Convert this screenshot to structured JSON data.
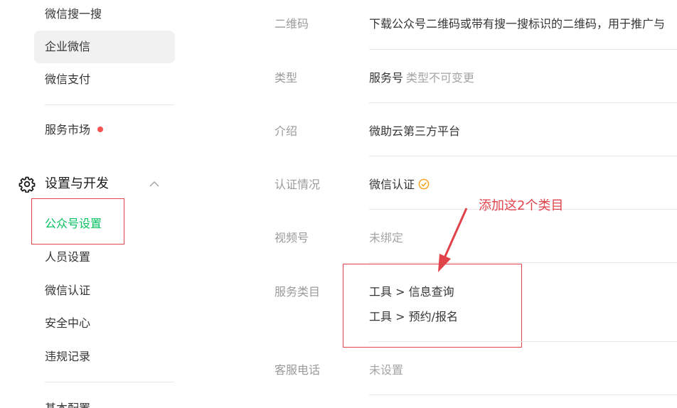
{
  "sidebar": {
    "items_top": [
      {
        "label": "微信搜一搜"
      },
      {
        "label": "企业微信"
      },
      {
        "label": "微信支付"
      }
    ],
    "service_market": {
      "label": "服务市场"
    },
    "section": {
      "title": "设置与开发",
      "icon": "gear-icon"
    },
    "sub_items": [
      {
        "label": "公众号设置"
      },
      {
        "label": "人员设置"
      },
      {
        "label": "微信认证"
      },
      {
        "label": "安全中心"
      },
      {
        "label": "违规记录"
      }
    ],
    "next_item": {
      "label": "基本配置"
    }
  },
  "main": {
    "qrcode": {
      "label": "二维码",
      "value": "下载公众号二维码或带有搜一搜标识的二维码，用于推广与"
    },
    "type": {
      "label": "类型",
      "value": "服务号",
      "hint": "类型不可变更"
    },
    "intro": {
      "label": "介绍",
      "value": "微助云第三方平台"
    },
    "verify": {
      "label": "认证情况",
      "value": "微信认证"
    },
    "video": {
      "label": "视频号",
      "value": "未绑定"
    },
    "categories": {
      "label": "服务类目",
      "items": [
        "工具 > 信息查询",
        "工具 > 预约/报名"
      ]
    },
    "phone": {
      "label": "客服电话",
      "value": "未设置"
    }
  },
  "annotation": {
    "text": "添加这2个类目"
  },
  "colors": {
    "accent": "#07c160",
    "annotation": "#e1434b",
    "dot": "#fa5151",
    "check": "#f5a623"
  }
}
